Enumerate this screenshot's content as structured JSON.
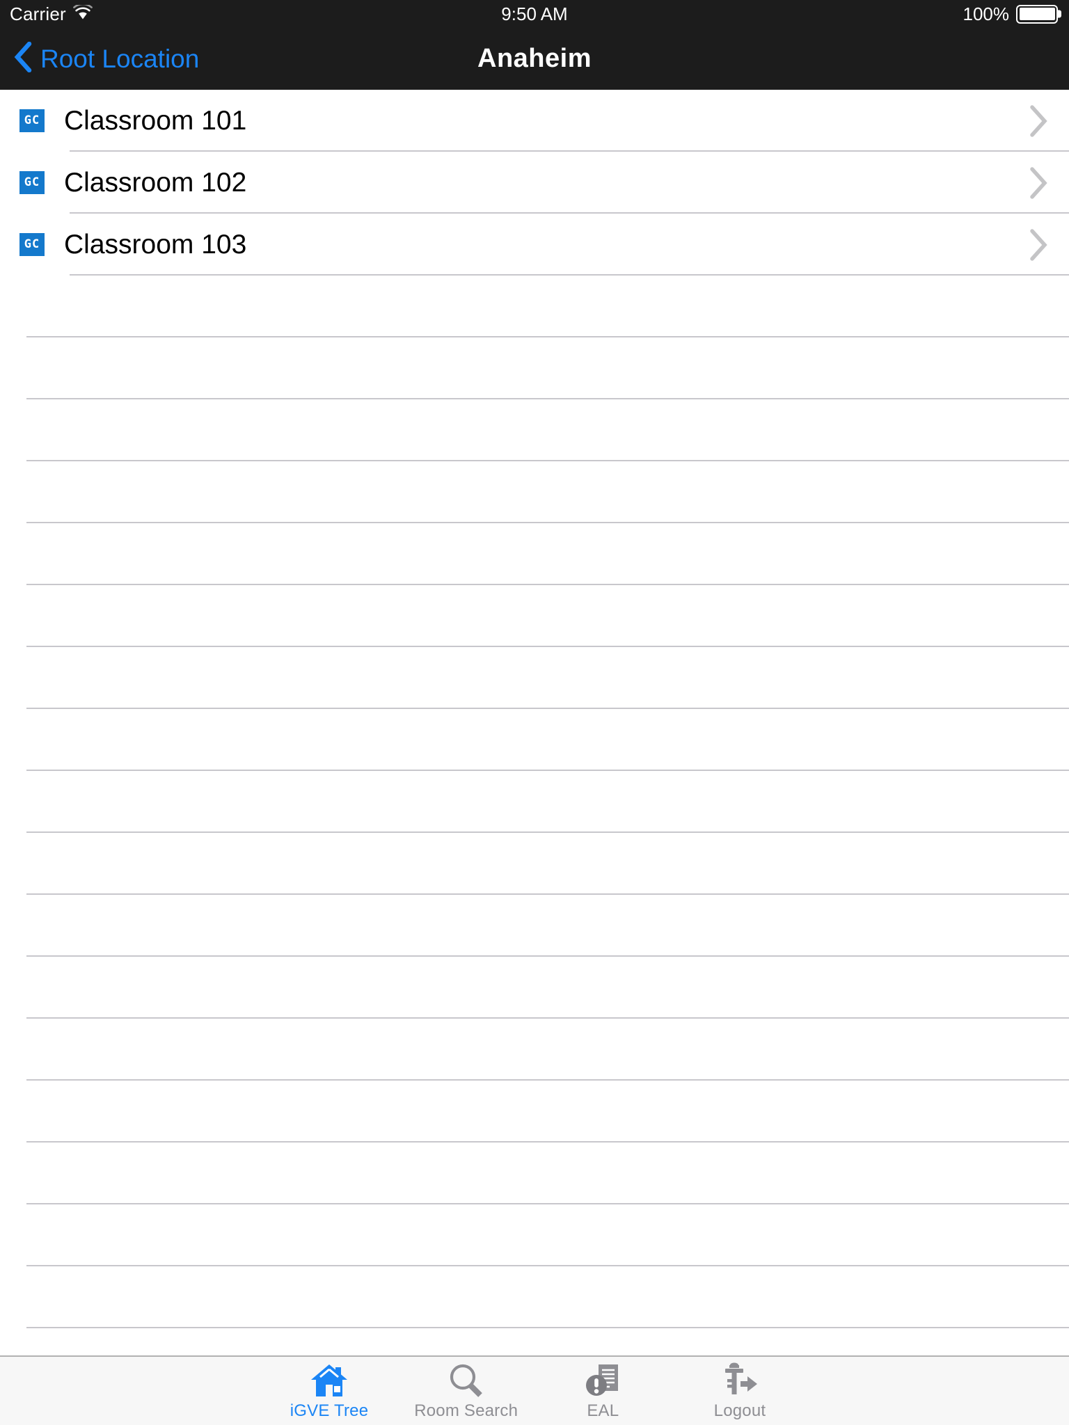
{
  "status_bar": {
    "carrier": "Carrier",
    "wifi_icon": "wifi-icon",
    "time": "9:50 AM",
    "battery_percent": "100%",
    "battery_icon": "battery-full-icon"
  },
  "nav_bar": {
    "back_icon": "chevron-left-icon",
    "back_label": "Root Location",
    "title": "Anaheim",
    "accent_color": "#1b85f5",
    "background_color": "#1c1c1c"
  },
  "list": {
    "row_icon_label": "GC",
    "row_icon_color": "#1479cc",
    "disclosure_icon": "chevron-right-icon",
    "separator_color": "#c8c7cc",
    "items": [
      {
        "label": "Classroom 101",
        "icon": "GC"
      },
      {
        "label": "Classroom 102",
        "icon": "GC"
      },
      {
        "label": "Classroom 103",
        "icon": "GC"
      }
    ],
    "empty_row_count": 18
  },
  "tab_bar": {
    "background_color": "#f7f7f7",
    "active_color": "#1b85f5",
    "inactive_color": "#8e8e93",
    "tabs": [
      {
        "label": "iGVE Tree",
        "icon": "home-icon",
        "active": true
      },
      {
        "label": "Room Search",
        "icon": "magnifier-icon",
        "active": false
      },
      {
        "label": "EAL",
        "icon": "document-alert-icon",
        "active": false
      },
      {
        "label": "Logout",
        "icon": "key-exit-icon",
        "active": false
      }
    ]
  }
}
